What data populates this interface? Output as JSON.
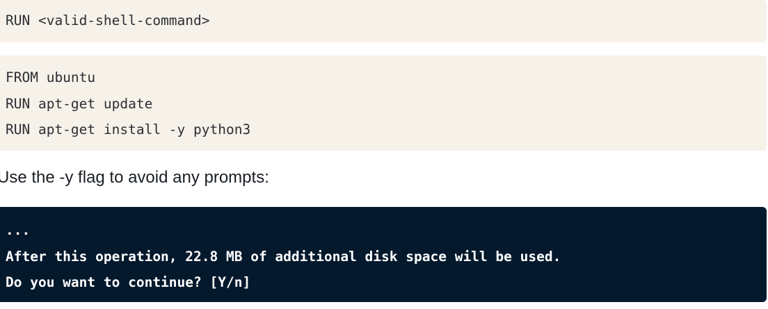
{
  "syntax_block": {
    "lines": [
      "RUN <valid-shell-command>"
    ]
  },
  "example_block": {
    "lines": [
      "FROM ubuntu",
      "RUN apt-get update",
      "RUN apt-get install -y python3"
    ]
  },
  "explanation": {
    "text": "Use the -y flag to avoid any prompts:"
  },
  "terminal_output": {
    "lines": [
      "...",
      "After this operation, 22.8 MB of additional disk space will be used.",
      "Do you want to continue? [Y/n]"
    ]
  },
  "colors": {
    "light_code_background": "#f6f1e9",
    "dark_code_background": "#05192d",
    "dark_code_text": "#ffffff"
  }
}
